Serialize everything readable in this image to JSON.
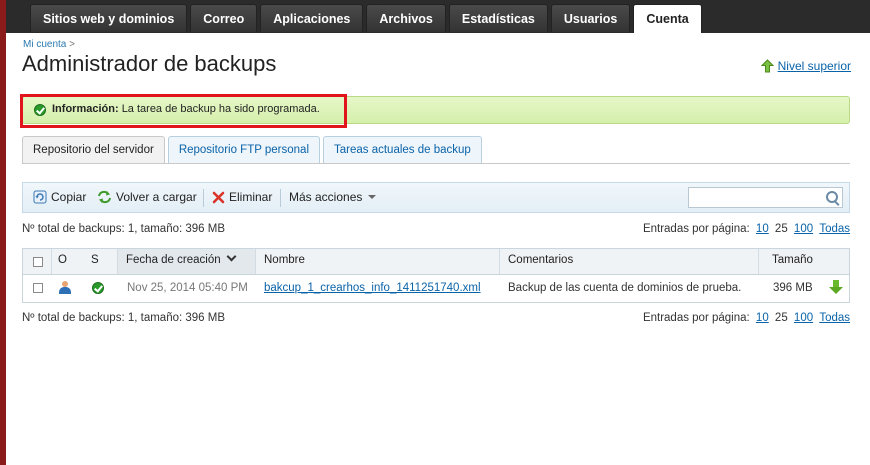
{
  "top_tabs": [
    {
      "label": "Sitios web y dominios",
      "active": false
    },
    {
      "label": "Correo",
      "active": false
    },
    {
      "label": "Aplicaciones",
      "active": false
    },
    {
      "label": "Archivos",
      "active": false
    },
    {
      "label": "Estadísticas",
      "active": false
    },
    {
      "label": "Usuarios",
      "active": false
    },
    {
      "label": "Cuenta",
      "active": true
    }
  ],
  "breadcrumb": {
    "link": "Mi cuenta",
    "separator": ">"
  },
  "page_title": "Administrador de backups",
  "up_level_label": "Nivel superior",
  "info": {
    "prefix": "Información:",
    "message": "La tarea de backup ha sido programada."
  },
  "sub_tabs": [
    {
      "label": "Repositorio del servidor",
      "active": true
    },
    {
      "label": "Repositorio FTP personal",
      "active": false
    },
    {
      "label": "Tareas actuales de backup",
      "active": false
    }
  ],
  "toolbar": {
    "copy": "Copiar",
    "reload": "Volver a cargar",
    "delete": "Eliminar",
    "more": "Más acciones",
    "search_placeholder": ""
  },
  "summary_text": "Nº total de backups: 1, tamaño: 396 MB",
  "pager": {
    "label": "Entradas por página:",
    "options": [
      "10",
      "25",
      "100",
      "Todas"
    ],
    "current": "25"
  },
  "table": {
    "headers": {
      "o": "O",
      "s": "S",
      "date": "Fecha de creación",
      "name": "Nombre",
      "comments": "Comentarios",
      "size": "Tamaño"
    },
    "rows": [
      {
        "date": "Nov 25, 2014 05:40 PM",
        "name": "bakcup_1_crearhos_info_1411251740.xml",
        "comment": "Backup de las cuenta de dominios de prueba.",
        "size": "396 MB"
      }
    ]
  },
  "colors": {
    "accent_link": "#0a63a8",
    "info_bg": "#d5efab",
    "highlight_frame": "#e1141c",
    "topbar": "#2b2b2b"
  }
}
